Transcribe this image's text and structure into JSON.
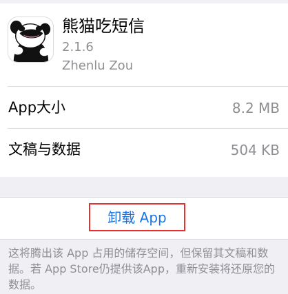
{
  "app": {
    "name": "熊猫吃短信",
    "version": "2.1.6",
    "developer": "Zhenlu Zou",
    "icon": "panda-app-icon"
  },
  "storage_rows": [
    {
      "label": "App大小",
      "value": "8.2 MB"
    },
    {
      "label": "文稿与数据",
      "value": "504 KB"
    }
  ],
  "actions": {
    "offload_label": "卸载 App",
    "offload_color": "#1a73e8",
    "highlight_color": "#e8302c"
  },
  "footer": {
    "note": "这将腾出该 App 占用的储存空间，但保留其文稿和数据。若 App Store仍提供该App，重新安装将还原您的数据。"
  }
}
